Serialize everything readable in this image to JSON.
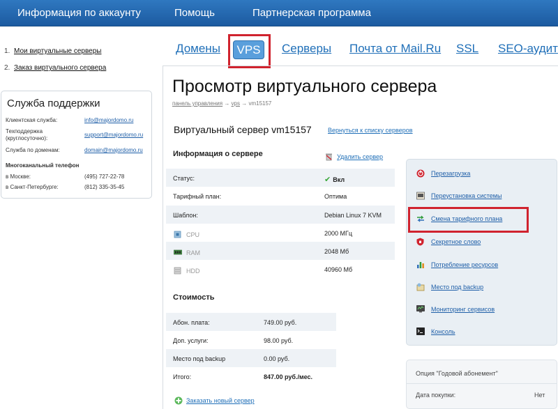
{
  "topnav": {
    "account": "Информация по аккаунту",
    "help": "Помощь",
    "partner": "Партнерская программа"
  },
  "sidebar": {
    "links": [
      {
        "num": "1.",
        "label": "Мои виртуальные серверы"
      },
      {
        "num": "2.",
        "label": "Заказ виртуального сервера"
      }
    ],
    "support": {
      "title": "Служба поддержки",
      "client_label": "Клиентская служба:",
      "client_email": "info@majordomo.ru",
      "tech_label_1": "Техподдержка",
      "tech_label_2": "(круглосуточно):",
      "tech_email": "support@majordomo.ru",
      "domain_label": "Служба по доменам:",
      "domain_email": "domain@majordomo.ru",
      "multiline_title": "Многоканальный телефон",
      "moscow_label": "в Москве:",
      "moscow_phone": "(495) 727-22-78",
      "spb_label": "в Санкт-Петербурге:",
      "spb_phone": "(812) 335-35-45"
    }
  },
  "tabs": {
    "domains": "Домены",
    "vps": "VPS",
    "servers": "Серверы",
    "mail": "Почта от Mail.Ru",
    "ssl": "SSL",
    "seo": "SEO-аудит"
  },
  "main": {
    "title": "Просмотр виртуального сервера",
    "breadcrumb": {
      "control_panel": "панель управления",
      "sep": "→",
      "vps": "vps",
      "current": "vm15157"
    },
    "server_heading": "Виртуальный сервер vm15157",
    "back_link": "Вернуться к списку серверов",
    "info_title": "Информация о сервере",
    "delete_label": "Удалить сервер",
    "info_rows": [
      {
        "label": "Статус:",
        "value": "Вкл"
      },
      {
        "label": "Тарифный план:",
        "value": "Оптима"
      },
      {
        "label": "Шаблон:",
        "value": "Debian Linux 7 KVM"
      },
      {
        "label": "CPU",
        "value": "2000 МГц"
      },
      {
        "label": "RAM",
        "value": "2048 Мб"
      },
      {
        "label": "HDD",
        "value": "40960 Мб"
      }
    ],
    "cost_title": "Стоимость",
    "cost_rows": [
      {
        "label": "Абон. плата:",
        "value": "749.00 руб."
      },
      {
        "label": "Доп. услуги:",
        "value": "98.00 руб."
      },
      {
        "label": "Место под backup",
        "value": "0.00 руб."
      },
      {
        "label": "Итого:",
        "value": "847.00 руб./мес."
      }
    ],
    "order_link": "Заказать новый сервер"
  },
  "actions": [
    {
      "label": "Перезагрузка"
    },
    {
      "label": "Переустановка системы"
    },
    {
      "label": "Смена тарифного плана"
    },
    {
      "label": "Секретное слово"
    },
    {
      "label": "Потребление ресурсов"
    },
    {
      "label": "Место под backup"
    },
    {
      "label": "Мониторинг сервисов"
    },
    {
      "label": "Консоль"
    }
  ],
  "option_panel": {
    "title": "Опция \"Годовой абонемент\"",
    "purchase_label": "Дата покупки:",
    "purchase_value": "Нет"
  },
  "colors": {
    "accent": "#1f6fb8",
    "highlight": "#d0232e",
    "header": "#2266ad"
  }
}
